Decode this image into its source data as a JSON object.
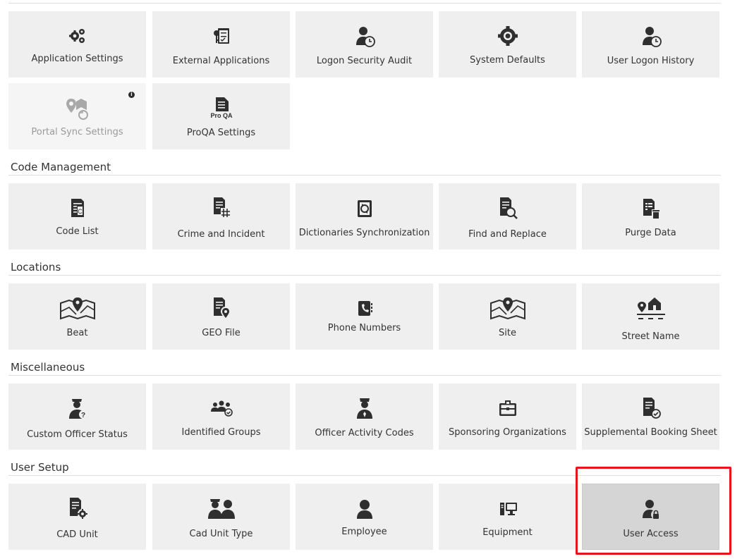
{
  "sections": {
    "code_management": "Code Management",
    "locations": "Locations",
    "miscellaneous": "Miscellaneous",
    "user_setup": "User Setup"
  },
  "tiles": {
    "application_settings": {
      "label": "Application Settings",
      "icon": "gears-icon"
    },
    "external_applications": {
      "label": "External Applications",
      "icon": "key-checklist-icon"
    },
    "logon_security_audit": {
      "label": "Logon Security Audit",
      "icon": "user-clock-icon"
    },
    "system_defaults": {
      "label": "System Defaults",
      "icon": "gear-icon"
    },
    "user_logon_history": {
      "label": "User Logon History",
      "icon": "user-clock-icon"
    },
    "portal_sync_settings": {
      "label": "Portal Sync Settings",
      "icon": "map-sync-icon",
      "info": "i"
    },
    "proqa_settings": {
      "label": "ProQA Settings",
      "icon": "proqa-document-icon",
      "icon_text": "Pro QA"
    },
    "code_list": {
      "label": "Code List",
      "icon": "code-list-icon"
    },
    "crime_and_incident": {
      "label": "Crime and Incident",
      "icon": "document-hash-icon"
    },
    "dictionaries_sync": {
      "label": "Dictionaries Synchronization",
      "icon": "book-sync-icon"
    },
    "find_and_replace": {
      "label": "Find and Replace",
      "icon": "document-search-icon"
    },
    "purge_data": {
      "label": "Purge Data",
      "icon": "document-trash-icon"
    },
    "beat": {
      "label": "Beat",
      "icon": "map-pin-icon"
    },
    "geo_file": {
      "label": "GEO File",
      "icon": "document-pin-icon"
    },
    "phone_numbers": {
      "label": "Phone Numbers",
      "icon": "phone-book-icon"
    },
    "site": {
      "label": "Site",
      "icon": "map-pin-icon"
    },
    "street_name": {
      "label": "Street Name",
      "icon": "street-house-icon"
    },
    "custom_officer_status": {
      "label": "Custom Officer Status",
      "icon": "officer-question-icon"
    },
    "identified_groups": {
      "label": "Identified Groups",
      "icon": "group-check-icon"
    },
    "officer_activity_codes": {
      "label": "Officer Activity Codes",
      "icon": "officer-icon"
    },
    "sponsoring_organizations": {
      "label": "Sponsoring Organizations",
      "icon": "briefcase-icon"
    },
    "supplemental_booking_sheet": {
      "label": "Supplemental Booking Sheet",
      "icon": "document-check-icon"
    },
    "cad_unit": {
      "label": "CAD Unit",
      "icon": "document-gear-icon"
    },
    "cad_unit_type": {
      "label": "Cad Unit Type",
      "icon": "officer-user-icon"
    },
    "employee": {
      "label": "Employee",
      "icon": "user-icon"
    },
    "equipment": {
      "label": "Equipment",
      "icon": "computer-icon"
    },
    "user_access": {
      "label": "User Access",
      "icon": "user-lock-icon",
      "selected": true
    }
  },
  "colors": {
    "tile_bg": "#efefef",
    "tile_selected_bg": "#d5d5d5",
    "icon": "#2f2f2f",
    "highlight": "#e8141c"
  }
}
